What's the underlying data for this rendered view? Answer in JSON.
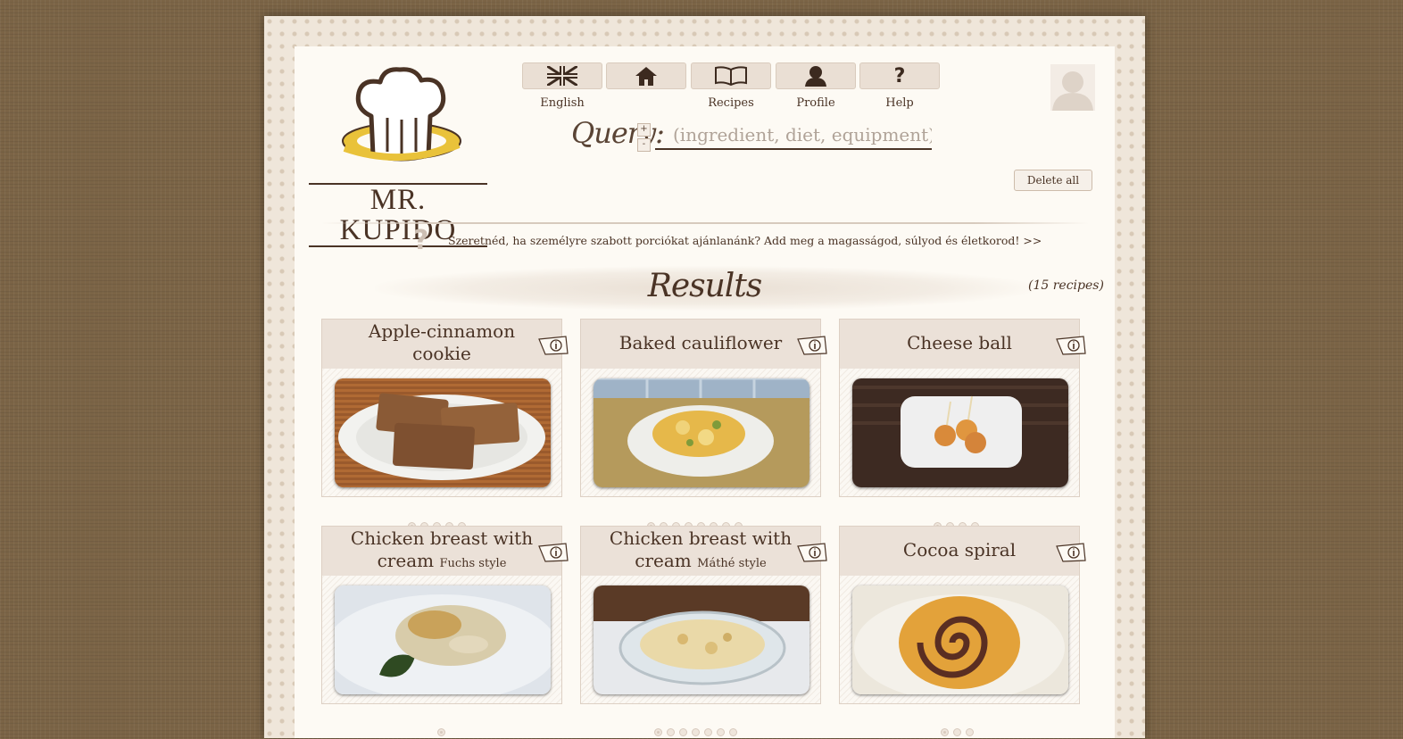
{
  "brand": {
    "logo_text": "MR. KUPIDO"
  },
  "nav": [
    {
      "key": "english",
      "label": "English",
      "icon": "uk-flag-icon"
    },
    {
      "key": "home",
      "label": "",
      "icon": "home-icon"
    },
    {
      "key": "recipes",
      "label": "Recipes",
      "icon": "book-icon"
    },
    {
      "key": "profile",
      "label": "Profile",
      "icon": "user-icon"
    },
    {
      "key": "help",
      "label": "Help",
      "icon": "question-icon"
    }
  ],
  "query": {
    "label": "Query:",
    "plus": "+",
    "minus": "-",
    "placeholder": "(ingredient, diet, equipment)"
  },
  "delete_all_label": "Delete all",
  "tip": {
    "icon": "?",
    "text": "Szeretnéd, ha személyre szabott porciókat ajánlanánk? Add meg a magasságod, súlyod és életkorod! >>"
  },
  "results": {
    "title": "Results",
    "count": "(15 recipes)"
  },
  "cards": [
    {
      "title": "Apple-cinnamon cookie",
      "subtitle": "",
      "dots": 5,
      "active": 0
    },
    {
      "title": "Baked cauliflower",
      "subtitle": "",
      "dots": 8,
      "active": 0
    },
    {
      "title": "Cheese ball",
      "subtitle": "",
      "dots": 4,
      "active": 0
    },
    {
      "title": "Chicken breast with cream",
      "subtitle": "Fuchs style",
      "dots": 1,
      "active": 0
    },
    {
      "title": "Chicken breast with cream",
      "subtitle": "Máthé style",
      "dots": 7,
      "active": 0
    },
    {
      "title": "Cocoa spiral",
      "subtitle": "",
      "dots": 3,
      "active": 0
    }
  ],
  "colors": {
    "background": "#7b6446",
    "page": "#fdfaf4",
    "text": "#4a3325",
    "logo_ring": "#e9c23a"
  }
}
